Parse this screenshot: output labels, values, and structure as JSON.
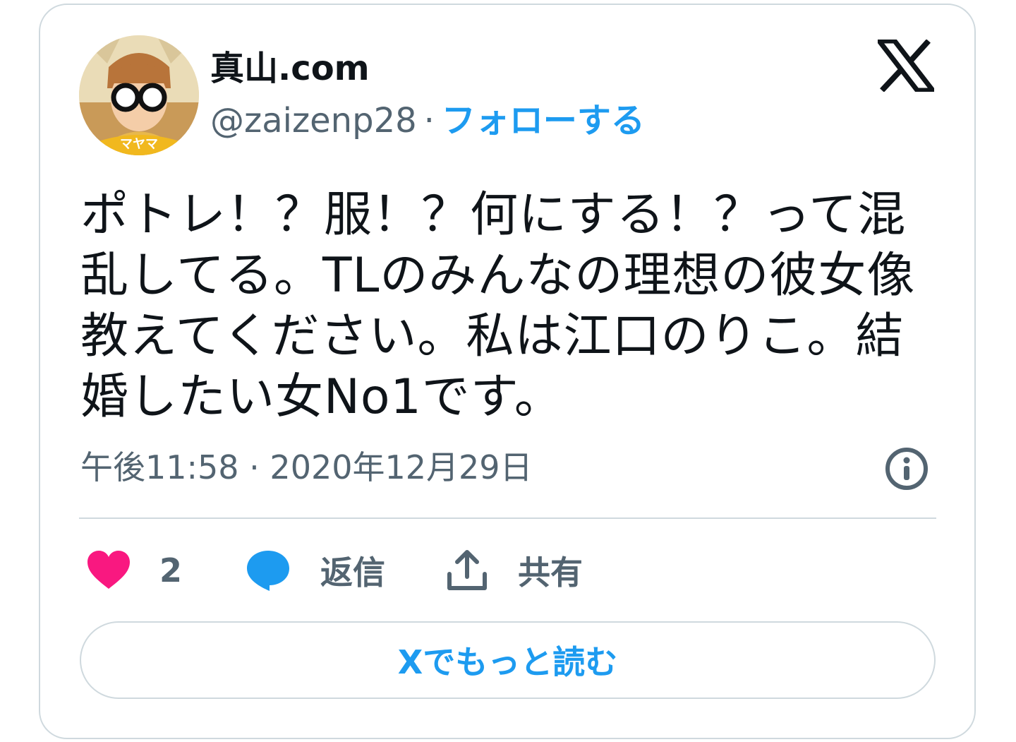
{
  "author": {
    "display_name": "真山.com",
    "handle": "@zaizenp28",
    "separator": "·",
    "follow_label": "フォローする",
    "avatar_badge": "マヤマ"
  },
  "tweet": {
    "text": "ポトレ！？服！？何にする！？って混乱してる。TLのみんなの理想の彼女像教えてください。私は江口のりこ。結婚したい女No1です。",
    "timestamp": "午後11:58 · 2020年12月29日"
  },
  "actions": {
    "like_count": "2",
    "reply_label": "返信",
    "share_label": "共有"
  },
  "read_more_label": "Xでもっと読む",
  "icons": {
    "brand": "x-logo-icon",
    "info": "info-icon",
    "like": "heart-icon",
    "reply": "speech-bubble-icon",
    "share": "upload-icon"
  },
  "colors": {
    "accent": "#1d9bf0",
    "like": "#f91880",
    "text": "#0f1419",
    "muted": "#536471",
    "border": "#cfd9de"
  }
}
